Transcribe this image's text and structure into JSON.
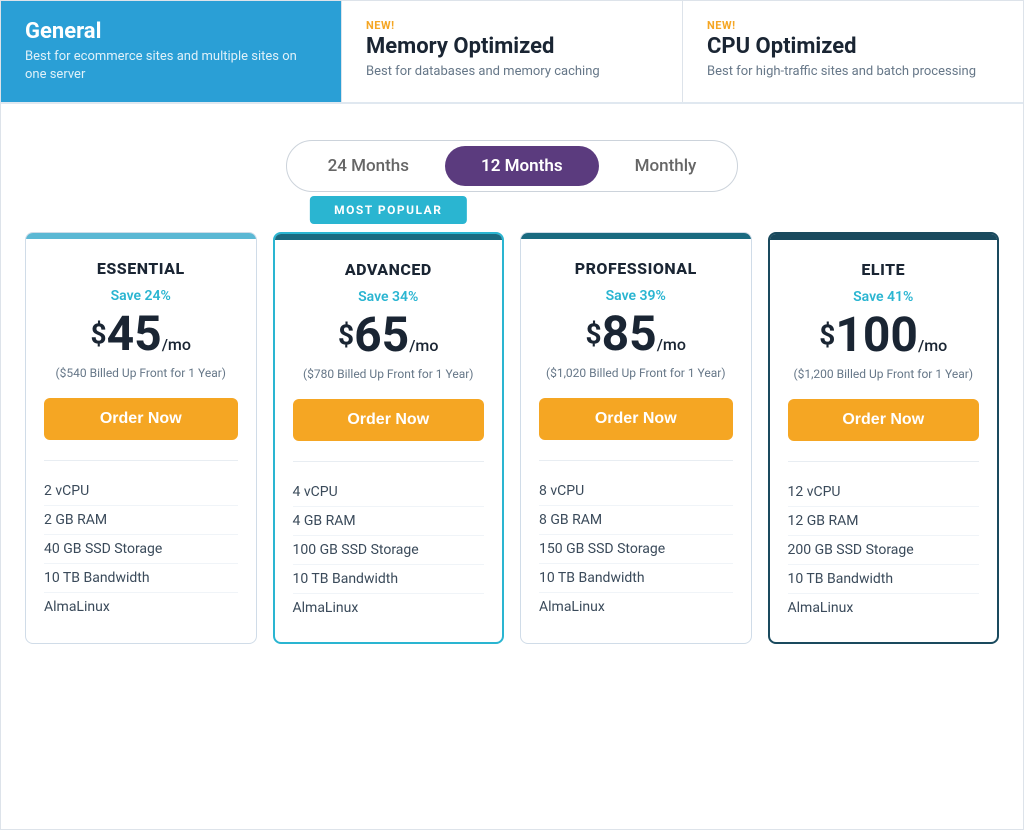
{
  "header": {
    "tabs": [
      {
        "id": "general",
        "title": "General",
        "description": "Best for ecommerce sites and multiple sites on one server",
        "new": false,
        "active": true
      },
      {
        "id": "memory",
        "title": "Memory Optimized",
        "description": "Best for databases and memory caching",
        "new": true,
        "active": false
      },
      {
        "id": "cpu",
        "title": "CPU Optimized",
        "description": "Best for high-traffic sites and batch processing",
        "new": true,
        "active": false
      }
    ]
  },
  "billing": {
    "options": [
      "24 Months",
      "12 Months",
      "Monthly"
    ],
    "active": "12 Months"
  },
  "popular_badge": "MOST POPULAR",
  "plans": [
    {
      "id": "essential",
      "name": "ESSENTIAL",
      "save": "Save 24%",
      "price": "45",
      "billed": "($540 Billed Up Front for 1 Year)",
      "order_label": "Order Now",
      "features": [
        "2 vCPU",
        "2 GB RAM",
        "40 GB SSD Storage",
        "10 TB Bandwidth",
        "AlmaLinux"
      ],
      "bar_class": "light-blue",
      "popular": false,
      "elite": false
    },
    {
      "id": "advanced",
      "name": "ADVANCED",
      "save": "Save 34%",
      "price": "65",
      "billed": "($780 Billed Up Front for 1 Year)",
      "order_label": "Order Now",
      "features": [
        "4 vCPU",
        "4 GB RAM",
        "100 GB SSD Storage",
        "10 TB Bandwidth",
        "AlmaLinux"
      ],
      "bar_class": "teal-dark",
      "popular": true,
      "elite": false
    },
    {
      "id": "professional",
      "name": "PROFESSIONAL",
      "save": "Save 39%",
      "price": "85",
      "billed": "($1,020 Billed Up Front for 1 Year)",
      "order_label": "Order Now",
      "features": [
        "8 vCPU",
        "8 GB RAM",
        "150 GB SSD Storage",
        "10 TB Bandwidth",
        "AlmaLinux"
      ],
      "bar_class": "teal-dark",
      "popular": false,
      "elite": false
    },
    {
      "id": "elite",
      "name": "ELITE",
      "save": "Save 41%",
      "price": "100",
      "billed": "($1,200 Billed Up Front for 1 Year)",
      "order_label": "Order Now",
      "features": [
        "12 vCPU",
        "12 GB RAM",
        "200 GB SSD Storage",
        "10 TB Bandwidth",
        "AlmaLinux"
      ],
      "bar_class": "navy",
      "popular": false,
      "elite": true
    }
  ]
}
